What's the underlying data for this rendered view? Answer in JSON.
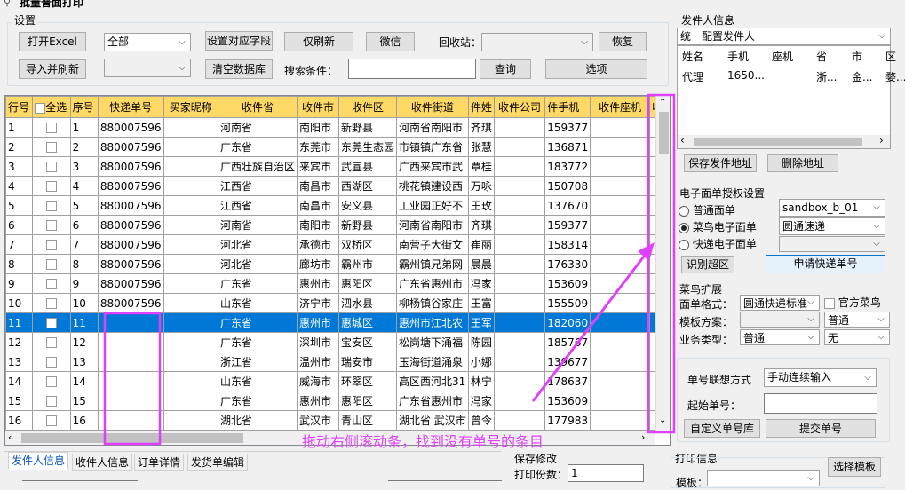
{
  "window": {
    "title": "批量普面打印"
  },
  "settings": {
    "group_label": "设置",
    "open_excel": "打开Excel",
    "import_refresh": "导入并刷新",
    "category_select": "全部",
    "category_select2": "",
    "set_fields": "设置对应字段",
    "clear_db": "清空数据库",
    "refresh_only": "仅刷新",
    "wechat": "微信",
    "recycle_label": "回收站：",
    "recycle_select": "",
    "restore": "恢复",
    "search_label": "搜索条件：",
    "search_value": "",
    "query": "查询",
    "options": "选项"
  },
  "grid": {
    "headers": [
      "行号",
      "全选",
      "序号",
      "快递单号",
      "买家昵称",
      "收件省",
      "收件市",
      "收件区",
      "收件街道",
      "件姓",
      "收件公司",
      "件手机",
      "收件座机",
      "收"
    ],
    "rows": [
      [
        "1",
        "",
        "1",
        "880007596",
        "",
        "河南省",
        "南阳市",
        "新野县",
        "河南省南阳市",
        "齐琪",
        "",
        "159377",
        ""
      ],
      [
        "2",
        "",
        "2",
        "880007596",
        "",
        "广东省",
        "东莞市",
        "东莞生态园",
        "市镇镇广东省",
        "张慧",
        "",
        "136871",
        ""
      ],
      [
        "3",
        "",
        "3",
        "880007596",
        "",
        "广西壮族自治区",
        "来宾市",
        "武宣县",
        "广西来宾市武",
        "覃桂",
        "",
        "183772",
        ""
      ],
      [
        "4",
        "",
        "4",
        "880007596",
        "",
        "江西省",
        "南昌市",
        "西湖区",
        "桃花镇建设西",
        "万咏",
        "",
        "150708",
        ""
      ],
      [
        "5",
        "",
        "5",
        "880007596",
        "",
        "江西省",
        "南昌市",
        "安义县",
        "工业园正好不",
        "王玫",
        "",
        "137670",
        ""
      ],
      [
        "6",
        "",
        "6",
        "880007596",
        "",
        "河南省",
        "南阳市",
        "新野县",
        "河南省南阳市",
        "齐琪",
        "",
        "159377",
        ""
      ],
      [
        "7",
        "",
        "7",
        "880007596",
        "",
        "河北省",
        "承德市",
        "双桥区",
        "南营子大街文",
        "崔丽",
        "",
        "158314",
        ""
      ],
      [
        "8",
        "",
        "8",
        "880007596",
        "",
        "河北省",
        "廊坊市",
        "霸州市",
        "霸州镇兄弟网",
        "晨晨",
        "",
        "176330",
        ""
      ],
      [
        "9",
        "",
        "9",
        "880007596",
        "",
        "广东省",
        "惠州市",
        "惠阳区",
        "广东省惠州市",
        "冯家",
        "",
        "153609",
        ""
      ],
      [
        "10",
        "",
        "10",
        "880007596",
        "",
        "山东省",
        "济宁市",
        "泗水县",
        "柳杨镇谷家庄",
        "王富",
        "",
        "155509",
        ""
      ],
      [
        "11",
        "",
        "11",
        "",
        "",
        "广东省",
        "惠州市",
        "惠城区",
        "惠州市江北农",
        "王军",
        "",
        "182060",
        ""
      ],
      [
        "12",
        "",
        "12",
        "",
        "",
        "广东省",
        "深圳市",
        "宝安区",
        "松岗塘下涌福",
        "陈园",
        "",
        "185767",
        ""
      ],
      [
        "13",
        "",
        "13",
        "",
        "",
        "浙江省",
        "温州市",
        "瑞安市",
        "玉海街道涌泉",
        "小娜",
        "",
        "139677",
        ""
      ],
      [
        "14",
        "",
        "14",
        "",
        "",
        "山东省",
        "威海市",
        "环翠区",
        "高区西河北31",
        "林宁",
        "",
        "178637",
        ""
      ],
      [
        "15",
        "",
        "15",
        "",
        "",
        "广东省",
        "惠州市",
        "惠阳区",
        "广东省惠州市",
        "冯家",
        "",
        "153609",
        ""
      ],
      [
        "16",
        "",
        "16",
        "",
        "",
        "湖北省",
        "武汉市",
        "青山区",
        "湖北省 武汉市",
        "曾令",
        "",
        "177983",
        ""
      ]
    ],
    "selected_row": "11"
  },
  "annotation": {
    "text": "拖动右侧滚动条，找到没有单号的条目",
    "color": "#e040fb"
  },
  "bottom_tabs": [
    "发件人信息",
    "收件人信息",
    "订单详情",
    "发货单编辑"
  ],
  "save_section": {
    "label": "保存修改",
    "print_count_label": "打印份数：",
    "print_count": "1"
  },
  "print_info": {
    "label": "打印信息",
    "template_label": "模板：",
    "select_template": "选择模板"
  },
  "sender": {
    "label": "发件人信息",
    "config_select": "统一配置发件人",
    "headers": [
      "姓名",
      "手机",
      "座机",
      "省",
      "市",
      "区"
    ],
    "row": [
      "代理",
      "1650...",
      "",
      "浙...",
      "金...",
      "婺..."
    ],
    "save_addr": "保存发件地址",
    "delete_addr": "删除地址"
  },
  "eorder": {
    "label": "电子面单授权设置",
    "radios": [
      "普通面单",
      "菜鸟电子面单",
      "快递电子面单"
    ],
    "selected": "菜鸟电子面单",
    "account_select": "sandbox_b_01",
    "express_select": "圆通速递",
    "third_select": "",
    "identify_btn": "识别超区",
    "apply_btn": "申请快递单号"
  },
  "cainiao": {
    "label": "菜鸟扩展",
    "format_label": "面单格式：",
    "format_select": "圆通快递标准",
    "official_label": "官方菜鸟",
    "template_label": "模板方案：",
    "template_select": "",
    "template_select2": "普通",
    "business_label": "业务类型：",
    "business_select": "普通",
    "business_select2": "无"
  },
  "number": {
    "mode_label": "单号联想方式",
    "mode_select": "手动连续输入",
    "start_label": "起始单号：",
    "start_value": "",
    "custom_btn": "自定义单号库",
    "submit_btn": "提交单号"
  }
}
